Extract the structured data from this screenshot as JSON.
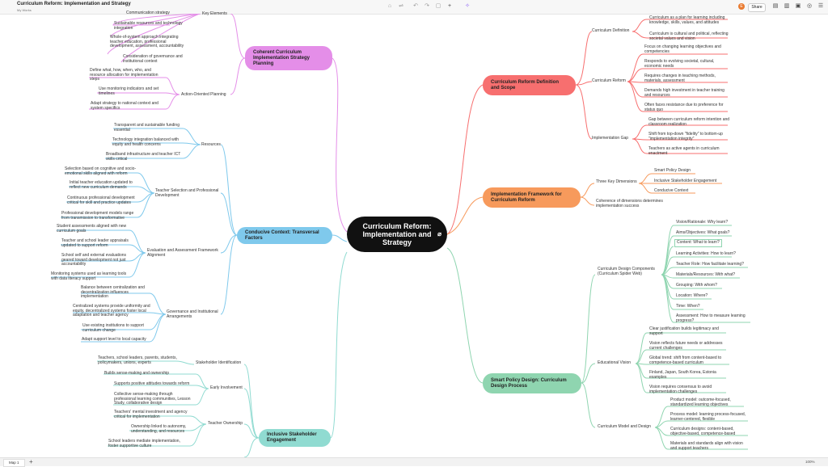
{
  "window": {
    "doc_title": "Curriculum Reform: Implementation and Strategy",
    "workspace": "My Works",
    "share_label": "Share",
    "avatar_initial": "E",
    "sheet_tab": "Map 1",
    "zoom": "100%"
  },
  "central": {
    "title": "Curriculum Reform: Implementation and Strategy"
  },
  "right": {
    "definition": {
      "title": "Curriculum Reform Definition and Scope",
      "sub1": "Curriculum Definition",
      "sub1_leaves": [
        "Curriculum as a plan for learning including knowledge, skills, values, and attitudes",
        "Curriculum is cultural and political, reflecting societal values and vision"
      ],
      "sub2": "Curriculum Reform",
      "sub2_leaves": [
        "Focus on changing learning objectives and competencies",
        "Responds to evolving societal, cultural, economic needs",
        "Requires changes in teaching methods, materials, assessment",
        "Demands high investment in teacher training and resources",
        "Often faces resistance due to preference for status quo"
      ],
      "sub3": "Implementation Gap",
      "sub3_leaves": [
        "Gap between curriculum reform intention and classroom realization",
        "Shift from top-down \"fidelity\" to bottom-up \"implementation integrity\"",
        "Teachers as active agents in curriculum enactment"
      ]
    },
    "framework": {
      "title": "Implementation Framework for Curriculum Reform",
      "sub1": "Three Key Dimensions",
      "sub1_leaves": [
        "Smart Policy Design",
        "Inclusive Stakeholder Engagement",
        "Conducive Context"
      ],
      "sub2": "Coherence of dimensions determines implementation success"
    },
    "smart": {
      "title": "Smart Policy Design: Curriculum Design Process",
      "sub1": "Curriculum Design Components (Curriculum Spider Web)",
      "sub1_leaves": [
        "Vision/Rationale: Why learn?",
        "Aims/Objectives: What goals?",
        "Content: What to learn?",
        "Learning Activities: How to learn?",
        "Teacher Role: How facilitate learning?",
        "Materials/Resources: With what?",
        "Grouping: With whom?",
        "Location: Where?",
        "Time: When?",
        "Assessment: How to measure learning progress?"
      ],
      "sub2": "Educational Vision",
      "sub2_leaves": [
        "Clear justification builds legitimacy and support",
        "Vision reflects future needs or addresses current challenges",
        "Global trend: shift from content-based to competence-based curriculum",
        "Finland, Japan, South Korea, Estonia examples",
        "Vision requires consensus to avoid implementation challenges"
      ],
      "sub3": "Curriculum Model and Design",
      "sub3_leaves": [
        "Product model: outcome-focused, standardized learning objectives",
        "Process model: learning process-focused, learner-centered, flexible",
        "Curriculum designs: content-based, objective-based, competence-based",
        "Materials and standards align with vision and support teachers"
      ]
    }
  },
  "left": {
    "coherent": {
      "title": "Coherent Curriculum Implementation Strategy Planning",
      "sub1": "Key Elements",
      "sub1_leaves": [
        "Communication strategy",
        "Sustainable resources and technology integration",
        "Whole-of-system approach integrating teacher education, professional development, assessment, accountability",
        "Consideration of governance and institutional context"
      ],
      "sub2": "Action-Oriented Planning",
      "sub2_leaves": [
        "Define what, how, when, who, and resource allocation for implementation steps",
        "Use monitoring indicators and set timelines",
        "Adapt strategy to national context and system specifics"
      ]
    },
    "context": {
      "title": "Conducive Context: Transversal Factors",
      "sub1": "Resources",
      "sub1_leaves": [
        "Transparent and sustainable funding essential",
        "Technology integration balanced with equity and health concerns",
        "Broadband infrastructure and teacher ICT skills critical"
      ],
      "sub2": "Teacher Selection and Professional Development",
      "sub2_leaves": [
        "Selection based on cognitive and socio-emotional skills aligned with reform",
        "Initial teacher education updated to reflect new curriculum demands",
        "Continuous professional development critical for skill and practice updates",
        "Professional development models range from transmission to transformative"
      ],
      "sub3": "Evaluation and Assessment Framework Alignment",
      "sub3_leaves": [
        "Student assessments aligned with new curriculum goals",
        "Teacher and school leader appraisals updated to support reform",
        "School self and external evaluations geared toward development not just accountability",
        "Monitoring systems used as learning tools with data literacy support"
      ],
      "sub4": "Governance and Institutional Arrangements",
      "sub4_leaves": [
        "Balance between centralization and decentralization influences implementation",
        "Centralized systems provide uniformity and equity, decentralized systems foster local adaptation and teacher agency",
        "Use existing institutions to support curriculum change",
        "Adapt support level to local capacity"
      ]
    },
    "inclusive": {
      "title": "Inclusive Stakeholder Engagement",
      "sub1": "Stakeholder Identification",
      "sub1_leaves": [
        "Teachers, school leaders, parents, students, policymakers, unions, experts"
      ],
      "sub2": "Early Involvement",
      "sub2_leaves": [
        "Builds sense-making and ownership",
        "Supports positive attitudes towards reform",
        "Collective sense-making through professional learning communities, Lesson Study, collaborative design"
      ],
      "sub3": "Teacher Ownership",
      "sub3_leaves": [
        "Teachers' mental investment and agency critical for implementation",
        "Ownership linked to autonomy, understanding, and resources",
        "School leaders mediate implementation, foster supportive culture"
      ]
    }
  },
  "colors": {
    "red": "#f76f6f",
    "orange": "#f79a5c",
    "green": "#8fd5b0",
    "magenta": "#e48ee8",
    "blue": "#7fc9ec",
    "teal": "#90dbd1"
  }
}
